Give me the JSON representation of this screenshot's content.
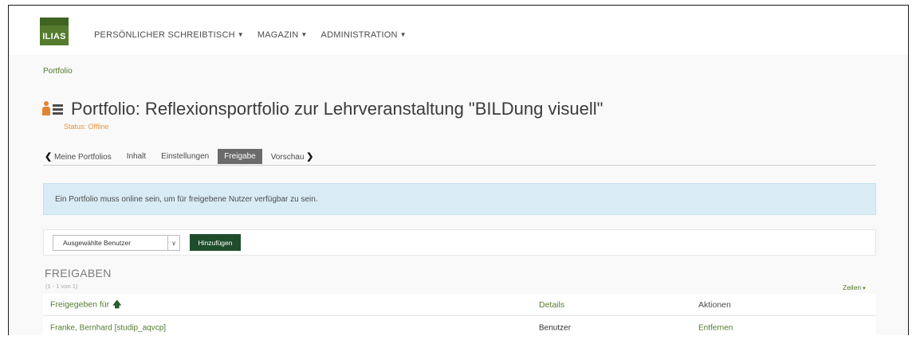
{
  "header": {
    "logo_text": "ILIAS",
    "nav": [
      {
        "label": "PERSÖNLICHER SCHREIBTISCH"
      },
      {
        "label": "MAGAZIN"
      },
      {
        "label": "ADMINISTRATION"
      }
    ]
  },
  "breadcrumb": "Portfolio",
  "page": {
    "title": "Portfolio: Reflexionsportfolio zur Lehrveranstaltung \"BILDung visuell\"",
    "status": "Status: Offline"
  },
  "tabs": [
    {
      "label": "Meine Portfolios"
    },
    {
      "label": "Inhalt"
    },
    {
      "label": "Einstellungen"
    },
    {
      "label": "Freigabe",
      "active": true
    },
    {
      "label": "Vorschau"
    }
  ],
  "info_message": "Ein Portfolio muss online sein, um für freigebene Nutzer verfügbar zu sein.",
  "toolbar": {
    "select_value": "Ausgewählte Benutzer",
    "add_label": "Hinzufügen"
  },
  "shares": {
    "title": "FREIGABEN",
    "counter": "(1 - 1 von 1)",
    "rows_label": "Zeilen",
    "columns": [
      "Freigegeben für",
      "Details",
      "Aktionen"
    ],
    "rows": [
      {
        "name": "Franke, Bernhard [studip_aqvcp]",
        "details": "Benutzer",
        "action": "Entfernen"
      }
    ]
  },
  "colors": {
    "accent_green": "#557b2e",
    "button_dark_green": "#1f4d2c",
    "status_orange": "#e8923b",
    "info_blue": "#d9ecf5",
    "active_tab": "#6b6b6b"
  }
}
